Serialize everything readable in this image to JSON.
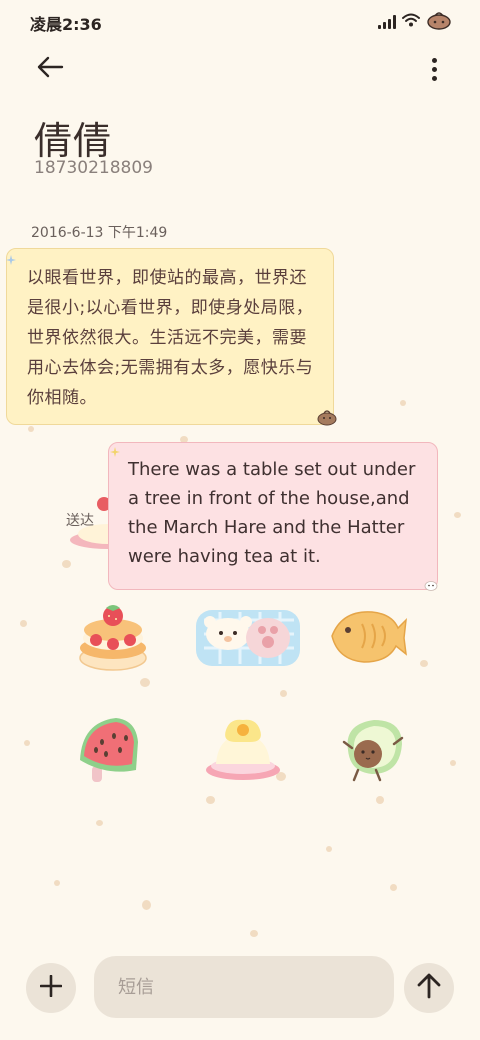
{
  "status_bar": {
    "time": "凌晨2:36",
    "icons": [
      "signal-icon",
      "wifi-icon",
      "theme-bag-icon"
    ]
  },
  "toolbar": {
    "back_icon": "back-arrow-icon",
    "more_icon": "more-vertical-icon"
  },
  "contact": {
    "name": "倩倩",
    "number": "18730218809"
  },
  "conversation": {
    "timestamp": "2016-6-13 下午1:49",
    "messages": [
      {
        "direction": "incoming",
        "text": "以眼看世界，即使站的最高，世界还是很小;以心看世界，即使身处局限，世界依然很大。生活远不完美，需要用心去体会;无需拥有太多，愿快乐与你相随。"
      },
      {
        "direction": "outgoing",
        "text": "There was a table set out under a tree in front of the house,and the March Hare and the Hatter were having tea at it.",
        "status": "送达"
      }
    ]
  },
  "wallpaper_stickers": [
    "strawberry-cake-icon",
    "bear-blanket-icon",
    "taiyaki-fish-icon",
    "watermelon-popsicle-icon",
    "pudding-icon",
    "avocado-icon"
  ],
  "composer": {
    "add_icon": "plus-icon",
    "placeholder": "短信",
    "value": "",
    "send_icon": "send-arrow-icon"
  },
  "colors": {
    "background": "#fdf8ee",
    "incoming_bubble": "#fff2c4",
    "outgoing_bubble": "#fde1e3",
    "composer": "#ebe3d7"
  }
}
